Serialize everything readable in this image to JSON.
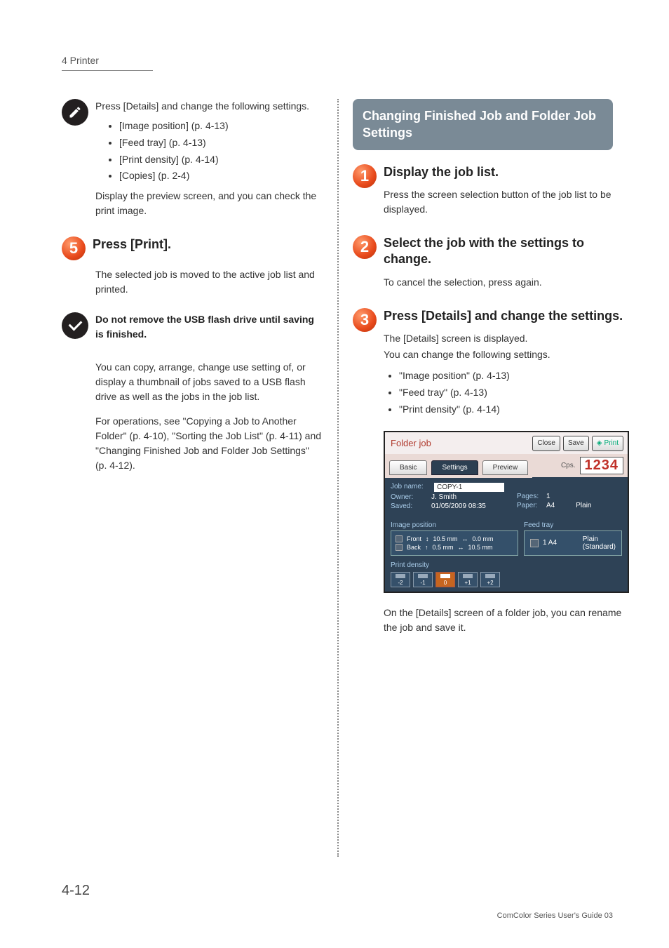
{
  "header": {
    "title": "4 Printer"
  },
  "left": {
    "tip1_intro": "Press [Details] and change the following settings.",
    "tip1_items": [
      "[Image position] (p. 4-13)",
      "[Feed tray] (p. 4-13)",
      "[Print density] (p. 4-14)",
      "[Copies] (p. 2-4)"
    ],
    "tip1_para": "Display the preview screen, and you can check the print image.",
    "step5_title": "Press [Print].",
    "step5_para": "The selected job is moved to the active job list and printed.",
    "warn": "Do not remove the USB flash drive until saving is finished.",
    "para2": "You can copy, arrange, change use setting of, or display a thumbnail of jobs saved to a USB flash drive as well as the jobs in the job list.",
    "para3": "For operations, see \"Copying a Job to Another Folder\" (p. 4-10), \"Sorting the Job List\" (p. 4-11) and \"Changing Finished Job and Folder Job Settings\" (p. 4-12)."
  },
  "right": {
    "section_title": "Changing Finished Job and Folder Job Settings",
    "step1_title": "Display the job list.",
    "step1_para": "Press the screen selection button of the job list to be displayed.",
    "step2_title": "Select the job with the settings to change.",
    "step2_para": "To cancel the selection, press again.",
    "step3_title": "Press [Details] and change the settings.",
    "step3_para1": "The [Details] screen is displayed.",
    "step3_para2": "You can change the following settings.",
    "step3_items": [
      "\"Image position\" (p. 4-13)",
      "\"Feed tray\" (p. 4-13)",
      "\"Print density\" (p. 4-14)"
    ],
    "caption": "On the [Details] screen of a folder job, you can rename the job and save it."
  },
  "scr": {
    "title": "Folder job",
    "btn_close": "Close",
    "btn_save": "Save",
    "btn_print": "Print",
    "cps_label": "Cps.",
    "cps_value": "1234",
    "tabs": {
      "basic": "Basic",
      "settings": "Settings",
      "preview": "Preview"
    },
    "job_name_k": "Job name:",
    "job_name_v": "COPY-1",
    "owner_k": "Owner:",
    "owner_v": "J. Smith",
    "saved_k": "Saved:",
    "saved_v": "01/05/2009 08:35",
    "pages_k": "Pages:",
    "pages_v": "1",
    "paper_k": "Paper:",
    "paper_v": "A4",
    "paper_type": "Plain",
    "img_pos_label": "Image position",
    "front": "Front",
    "front_v1": "10.5 mm",
    "front_v2": "0.0 mm",
    "back": "Back",
    "back_v1": "0.5 mm",
    "back_v2": "10.5 mm",
    "feed_label": "Feed tray",
    "feed_v": "1  A4",
    "feed_plain": "Plain",
    "feed_std": "(Standard)",
    "density_label": "Print density",
    "d_n2": "-2",
    "d_n1": "-1",
    "d_0": "0",
    "d_p1": "+1",
    "d_p2": "+2"
  },
  "page_number": "4-12",
  "footer": "ComColor Series User's Guide 03"
}
